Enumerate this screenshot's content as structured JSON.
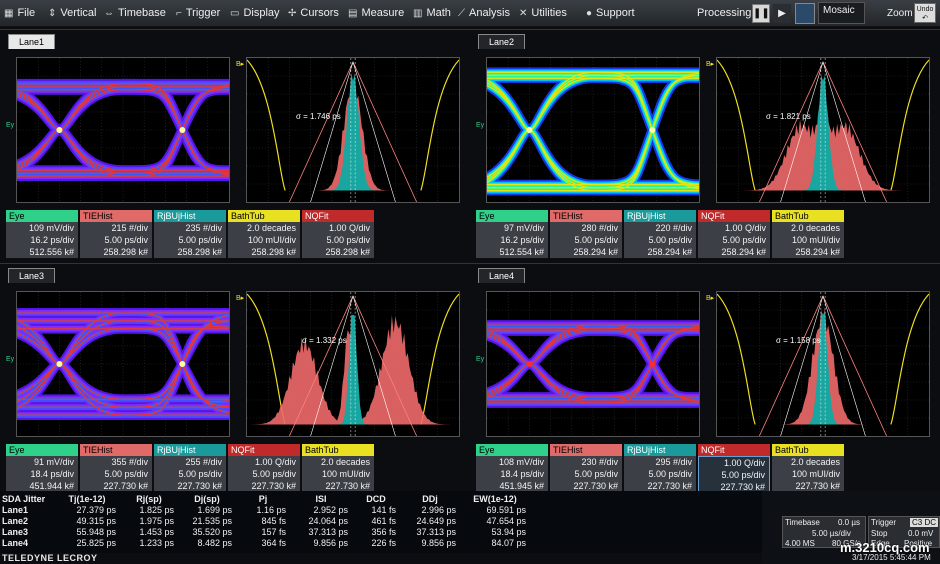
{
  "menu": [
    {
      "label": "File",
      "icon": "file-icon",
      "glyph": "▦"
    },
    {
      "label": "Vertical",
      "icon": "vertical-icon",
      "glyph": "⇕"
    },
    {
      "label": "Timebase",
      "icon": "timebase-icon",
      "glyph": "⇔"
    },
    {
      "label": "Trigger",
      "icon": "trigger-icon",
      "glyph": "⌐"
    },
    {
      "label": "Display",
      "icon": "display-icon",
      "glyph": "▭"
    },
    {
      "label": "Cursors",
      "icon": "cursors-icon",
      "glyph": "✢"
    },
    {
      "label": "Measure",
      "icon": "measure-icon",
      "glyph": "▤"
    },
    {
      "label": "Math",
      "icon": "math-icon",
      "glyph": "▥"
    },
    {
      "label": "Analysis",
      "icon": "analysis-icon",
      "glyph": "⟋"
    },
    {
      "label": "Utilities",
      "icon": "utilities-icon",
      "glyph": "✕"
    },
    {
      "label": "Support",
      "icon": "support-icon",
      "glyph": "●"
    }
  ],
  "toolbar": {
    "processing": "Processing:",
    "mosaic": "Mosaic",
    "zoom": "Zoom",
    "undo": "Undo"
  },
  "lanes": [
    {
      "tab": "Lane1",
      "sigma": "σ = 1.746 ps",
      "params": [
        {
          "name": "Eye",
          "color": "#2fd08a",
          "l1": "109 mV/div",
          "l2": "16.2 ps/div",
          "l3": "512.556 k#"
        },
        {
          "name": "TIEHist",
          "color": "#e06a68",
          "l1": "215 #/div",
          "l2": "5.00 ps/div",
          "l3": "258.298 k#"
        },
        {
          "name": "RjBUjHist",
          "color": "#1a9a9a",
          "l1": "235 #/div",
          "l2": "5.00 ps/div",
          "l3": "258.298 k#"
        },
        {
          "name": "BathTub",
          "color": "#e8e020",
          "l1": "2.0 decades",
          "l2": "100 mUI/div",
          "l3": "258.298 k#"
        },
        {
          "name": "NQFit",
          "color": "#c02a2a",
          "l1": "1.00 Q/div",
          "l2": "5.00 ps/div",
          "l3": "258.298 k#"
        }
      ]
    },
    {
      "tab": "Lane2",
      "sigma": "σ = 1.821 ps",
      "params": [
        {
          "name": "Eye",
          "color": "#2fd08a",
          "l1": "97 mV/div",
          "l2": "16.2 ps/div",
          "l3": "512.554 k#"
        },
        {
          "name": "TIEHist",
          "color": "#e06a68",
          "l1": "280 #/div",
          "l2": "5.00 ps/div",
          "l3": "258.294 k#"
        },
        {
          "name": "RjBUjHist",
          "color": "#1a9a9a",
          "l1": "220 #/div",
          "l2": "5.00 ps/div",
          "l3": "258.294 k#"
        },
        {
          "name": "NQFit",
          "color": "#c02a2a",
          "l1": "1.00 Q/div",
          "l2": "5.00 ps/div",
          "l3": "258.294 k#"
        },
        {
          "name": "BathTub",
          "color": "#e8e020",
          "l1": "2.0 decades",
          "l2": "100 mUI/div",
          "l3": "258.294 k#"
        }
      ]
    },
    {
      "tab": "Lane3",
      "sigma": "σ = 1.332 ps",
      "params": [
        {
          "name": "Eye",
          "color": "#2fd08a",
          "l1": "91 mV/div",
          "l2": "18.4 ps/div",
          "l3": "451.944 k#"
        },
        {
          "name": "TIEHist",
          "color": "#e06a68",
          "l1": "355 #/div",
          "l2": "5.00 ps/div",
          "l3": "227.730 k#"
        },
        {
          "name": "RjBUjHist",
          "color": "#1a9a9a",
          "l1": "255 #/div",
          "l2": "5.00 ps/div",
          "l3": "227.730 k#"
        },
        {
          "name": "NQFit",
          "color": "#c02a2a",
          "l1": "1.00 Q/div",
          "l2": "5.00 ps/div",
          "l3": "227.730 k#"
        },
        {
          "name": "BathTub",
          "color": "#e8e020",
          "l1": "2.0 decades",
          "l2": "100 mUI/div",
          "l3": "227.730 k#"
        }
      ]
    },
    {
      "tab": "Lane4",
      "sigma": "σ = 1.158 ps",
      "params": [
        {
          "name": "Eye",
          "color": "#2fd08a",
          "l1": "108 mV/div",
          "l2": "18.4 ps/div",
          "l3": "451.945 k#"
        },
        {
          "name": "TIEHist",
          "color": "#e06a68",
          "l1": "230 #/div",
          "l2": "5.00 ps/div",
          "l3": "227.730 k#"
        },
        {
          "name": "RjBUjHist",
          "color": "#1a9a9a",
          "l1": "295 #/div",
          "l2": "5.00 ps/div",
          "l3": "227.730 k#"
        },
        {
          "name": "NQFit",
          "color": "#c02a2a",
          "l1": "1.00 Q/div",
          "l2": "5.00 ps/div",
          "l3": "227.730 k#",
          "selected": true
        },
        {
          "name": "BathTub",
          "color": "#e8e020",
          "l1": "2.0 decades",
          "l2": "100 mUI/div",
          "l3": "227.730 k#"
        }
      ]
    }
  ],
  "jitter": {
    "headers": [
      "SDA Jitter",
      "Tj(1e-12)",
      "Rj(sp)",
      "Dj(sp)",
      "Pj",
      "ISI",
      "DCD",
      "DDj",
      "EW(1e-12)"
    ],
    "rows": [
      [
        "Lane1",
        "27.379 ps",
        "1.825 ps",
        "1.699 ps",
        "1.16 ps",
        "2.952 ps",
        "141 fs",
        "2.996 ps",
        "69.591 ps"
      ],
      [
        "Lane2",
        "49.315 ps",
        "1.975 ps",
        "21.535 ps",
        "845 fs",
        "24.064 ps",
        "461 fs",
        "24.649 ps",
        "47.654 ps"
      ],
      [
        "Lane3",
        "55.948 ps",
        "1.453 ps",
        "35.520 ps",
        "157 fs",
        "37.313 ps",
        "356 fs",
        "37.313 ps",
        "53.94 ps"
      ],
      [
        "Lane4",
        "25.825 ps",
        "1.233 ps",
        "8.482 ps",
        "364 fs",
        "9.856 ps",
        "226 fs",
        "9.856 ps",
        "84.07 ps"
      ]
    ]
  },
  "brand": "TELEDYNE LECROY",
  "status": {
    "timebase_label": "Timebase",
    "timebase_val": "0.0 µs",
    "timebase_div": "5.00 µs/div",
    "sample_l": "4.00 MS",
    "sample_r": "80 GS/s",
    "trigger_label": "Trigger",
    "trigger_mode": "C3 DC",
    "stop": "Stop",
    "trigger_level": "0.0 mV",
    "edge": "Edge",
    "slope": "Positive",
    "datetime": "3/17/2015 5:45:44 PM"
  },
  "watermark": "m.3210cq.com"
}
